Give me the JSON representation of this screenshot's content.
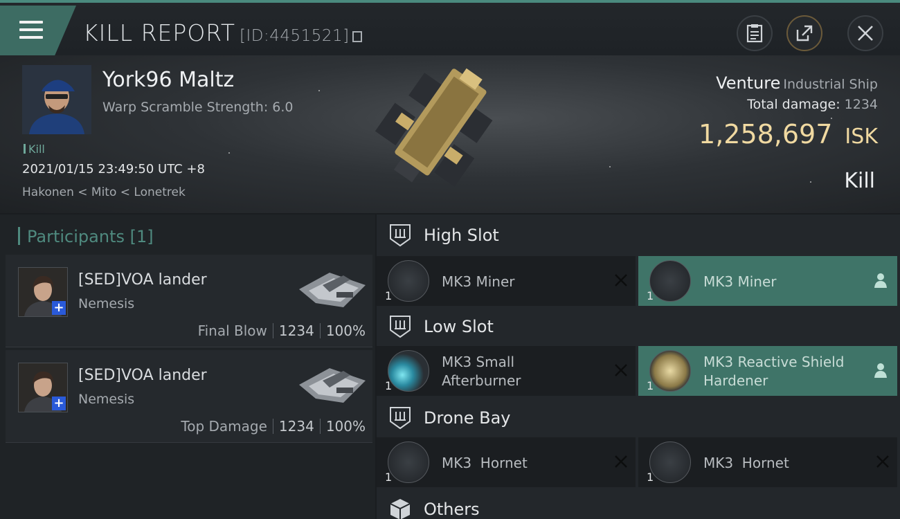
{
  "topbar": {
    "title": "KILL REPORT",
    "report_id": "[ID:4451521]"
  },
  "victim": {
    "name": "York96 Maltz",
    "warp_scramble": "Warp Scramble Strength: 6.0",
    "tag": "Kill",
    "time": "2021/01/15 23:49:50 UTC +8",
    "location": "Hakonen < Mito < Lonetrek"
  },
  "ship": {
    "name": "Venture",
    "class": "Industrial Ship",
    "total_damage_label": "Total damage:",
    "total_damage_value": "1234",
    "isk_value": "1,258,697",
    "isk_unit": "ISK",
    "result": "Kill"
  },
  "participants": {
    "title": "Participants [1]",
    "rows": [
      {
        "name": "[SED]VOA lander",
        "ship": "Nemesis",
        "label": "Final Blow",
        "damage": "1234",
        "percent": "100%"
      },
      {
        "name": "[SED]VOA lander",
        "ship": "Nemesis",
        "label": "Top Damage",
        "damage": "1234",
        "percent": "100%"
      }
    ]
  },
  "fitting": {
    "high_slot": {
      "label": "High Slot",
      "modules": [
        {
          "name": "MK3 Miner",
          "qty": "1",
          "icon": "miner-icon",
          "state": "destroyed"
        },
        {
          "name": "MK3 Miner",
          "qty": "1",
          "icon": "miner-icon",
          "state": "dropped"
        }
      ]
    },
    "low_slot": {
      "label": "Low Slot",
      "modules": [
        {
          "name_line1": "MK3 Small",
          "name_line2": "Afterburner",
          "qty": "1",
          "icon": "afterburner-icon",
          "state": "destroyed"
        },
        {
          "name_line1": "MK3 Reactive Shield",
          "name_line2": "Hardener",
          "qty": "1",
          "icon": "shield-hardener-icon",
          "state": "dropped"
        }
      ]
    },
    "drone_bay": {
      "label": "Drone Bay",
      "modules": [
        {
          "name": "MK3  Hornet",
          "qty": "1",
          "icon": "drone-icon",
          "state": "destroyed"
        },
        {
          "name": "MK3  Hornet",
          "qty": "1",
          "icon": "drone-icon",
          "state": "destroyed"
        }
      ]
    },
    "others": {
      "label": "Others"
    }
  },
  "colors": {
    "accent": "#4f8a7f",
    "active_module": "#3f7468",
    "isk": "#f0d9a1"
  }
}
